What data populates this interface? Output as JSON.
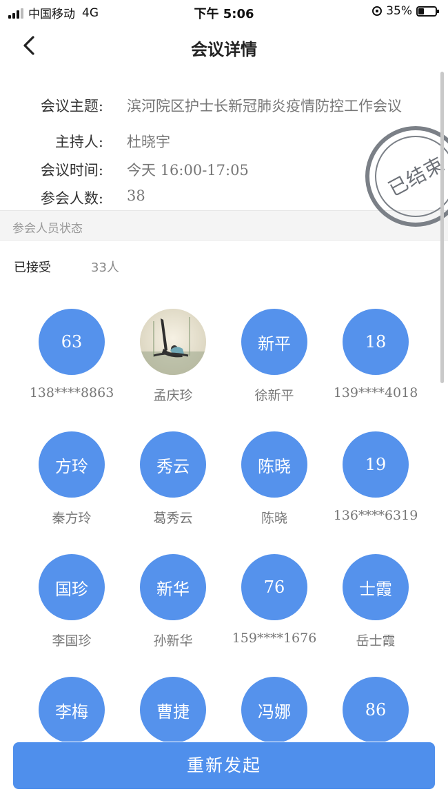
{
  "status_bar": {
    "carrier": "中国移动",
    "network": "4G",
    "time": "下午 5:06",
    "battery": "35%"
  },
  "nav": {
    "title": "会议详情"
  },
  "meeting": {
    "topic_label": "会议主题:",
    "topic": "滨河院区护士长新冠肺炎疫情防控工作会议",
    "host_label": "主持人:",
    "host": "杜晓宇",
    "time_label": "会议时间:",
    "time": "今天 16:00-17:05",
    "count_label": "参会人数:",
    "count": "38",
    "stamp": "已结束"
  },
  "attendees": {
    "section_title": "参会人员状态",
    "accepted_label": "已接受",
    "accepted_count": "33人",
    "members": [
      {
        "avatar": "63",
        "name": "138****8863"
      },
      {
        "avatar": "",
        "name": "孟庆珍",
        "photo": true
      },
      {
        "avatar": "新平",
        "name": "徐新平"
      },
      {
        "avatar": "18",
        "name": "139****4018"
      },
      {
        "avatar": "方玲",
        "name": "秦方玲"
      },
      {
        "avatar": "秀云",
        "name": "葛秀云"
      },
      {
        "avatar": "陈晓",
        "name": "陈晓"
      },
      {
        "avatar": "19",
        "name": "136****6319"
      },
      {
        "avatar": "国珍",
        "name": "李国珍"
      },
      {
        "avatar": "新华",
        "name": "孙新华"
      },
      {
        "avatar": "76",
        "name": "159****1676"
      },
      {
        "avatar": "士霞",
        "name": "岳士霞"
      },
      {
        "avatar": "李梅",
        "name": ""
      },
      {
        "avatar": "曹捷",
        "name": ""
      },
      {
        "avatar": "冯娜",
        "name": ""
      },
      {
        "avatar": "86",
        "name": ""
      }
    ]
  },
  "actions": {
    "restart_label": "重新发起"
  },
  "colors": {
    "accent": "#5592ec",
    "button": "#4f8fec",
    "stamp": "#7b8087"
  }
}
